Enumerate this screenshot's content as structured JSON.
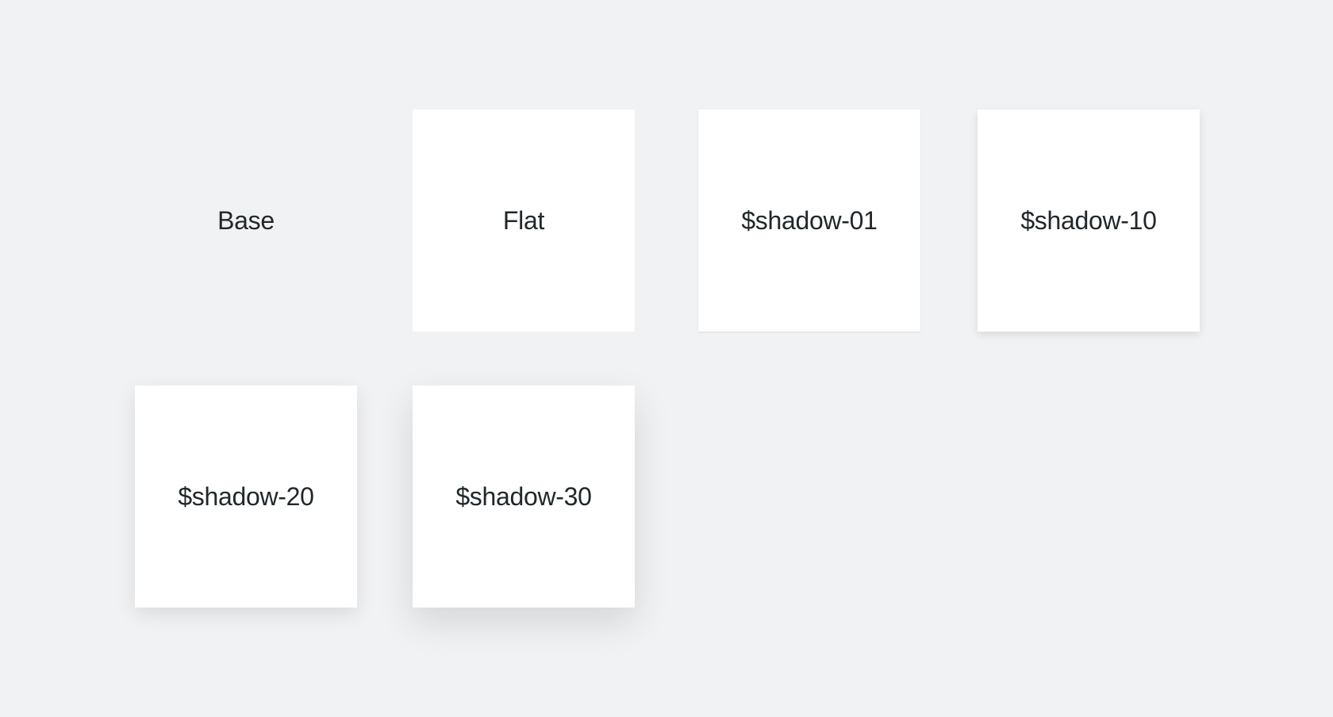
{
  "background_color": "#f1f2f4",
  "surface_color": "#ffffff",
  "text_color": "#21272a",
  "tiles": [
    {
      "label": "Base"
    },
    {
      "label": "Flat"
    },
    {
      "label": "$shadow-01"
    },
    {
      "label": "$shadow-10"
    },
    {
      "label": "$shadow-20"
    },
    {
      "label": "$shadow-30"
    }
  ]
}
